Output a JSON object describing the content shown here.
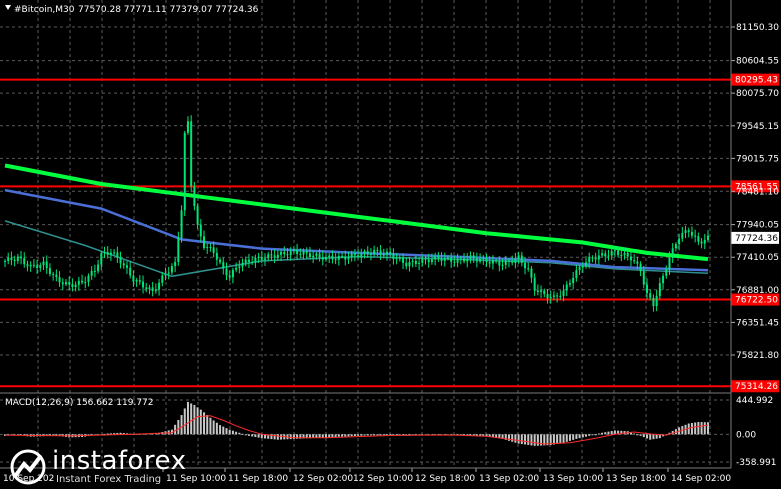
{
  "header": {
    "symbol": "#Bitcoin,M30",
    "ohlc": "77570.28 77771.11 77379.07 77724.36"
  },
  "colors": {
    "background": "#000000",
    "grid": "#5a5a5a",
    "candle": "#00e676",
    "sma_fast": "#00ff3c",
    "sma_mid": "#4a6fd6",
    "sma_slow": "#2f8f8f",
    "level": "#ff0000",
    "current_price_bg": "#ffffff",
    "macd_hist": "#c8c8c8",
    "macd_signal": "#ff2a2a"
  },
  "chart_data": {
    "type": "candlestick",
    "price_axis_ticks": [
      "81150.30",
      "80604.55",
      "80075.70",
      "79545.15",
      "79015.75",
      "78481.10",
      "77940.05",
      "77410.05",
      "76881.00",
      "76351.45",
      "75821.80"
    ],
    "price_axis_values": [
      81150.3,
      80604.55,
      80075.7,
      79545.15,
      79015.75,
      78481.1,
      77940.05,
      77410.05,
      76881.0,
      76351.45,
      75821.8
    ],
    "time_axis_ticks": [
      "11 Sep 10:00",
      "11 Sep 18:00",
      "12 Sep 02:00",
      "12 Sep 10:00",
      "12 Sep 18:00",
      "13 Sep 02:00",
      "13 Sep 10:00",
      "13 Sep 18:00",
      "14 Sep 02:00"
    ],
    "levels": [
      {
        "label": "80295.43",
        "value": 80295.43
      },
      {
        "label": "78561.55",
        "value": 78561.55
      },
      {
        "label": "76722.50",
        "value": 76722.5
      },
      {
        "label": "75314.26",
        "value": 75314.26
      }
    ],
    "current_price": {
      "label": "77724.36",
      "value": 77724.36
    },
    "close_path": [
      [
        0,
        77350
      ],
      [
        4,
        77400
      ],
      [
        8,
        77250
      ],
      [
        12,
        77300
      ],
      [
        16,
        77050
      ],
      [
        20,
        76950
      ],
      [
        24,
        77000
      ],
      [
        28,
        77200
      ],
      [
        30,
        77450
      ],
      [
        33,
        77500
      ],
      [
        36,
        77350
      ],
      [
        40,
        77050
      ],
      [
        43,
        76950
      ],
      [
        46,
        76850
      ],
      [
        50,
        77150
      ],
      [
        53,
        77300
      ],
      [
        55,
        78200
      ],
      [
        56,
        79400
      ],
      [
        57,
        79600
      ],
      [
        58,
        78600
      ],
      [
        60,
        77900
      ],
      [
        62,
        77600
      ],
      [
        65,
        77500
      ],
      [
        68,
        77200
      ],
      [
        70,
        77100
      ],
      [
        73,
        77300
      ],
      [
        76,
        77350
      ],
      [
        80,
        77400
      ],
      [
        85,
        77450
      ],
      [
        90,
        77500
      ],
      [
        95,
        77450
      ],
      [
        100,
        77400
      ],
      [
        105,
        77400
      ],
      [
        110,
        77450
      ],
      [
        115,
        77500
      ],
      [
        120,
        77450
      ],
      [
        125,
        77300
      ],
      [
        130,
        77350
      ],
      [
        135,
        77400
      ],
      [
        140,
        77350
      ],
      [
        145,
        77400
      ],
      [
        150,
        77350
      ],
      [
        155,
        77300
      ],
      [
        160,
        77400
      ],
      [
        163,
        77200
      ],
      [
        165,
        76900
      ],
      [
        168,
        76800
      ],
      [
        171,
        76750
      ],
      [
        174,
        76850
      ],
      [
        177,
        77100
      ],
      [
        180,
        77300
      ],
      [
        183,
        77400
      ],
      [
        187,
        77450
      ],
      [
        190,
        77500
      ],
      [
        195,
        77400
      ],
      [
        198,
        77200
      ],
      [
        200,
        76800
      ],
      [
        202,
        76650
      ],
      [
        204,
        76950
      ],
      [
        207,
        77400
      ],
      [
        210,
        77750
      ],
      [
        213,
        77850
      ],
      [
        216,
        77650
      ],
      [
        219,
        77720
      ]
    ],
    "sma_fast_path": [
      [
        0,
        78900
      ],
      [
        30,
        78600
      ],
      [
        60,
        78400
      ],
      [
        90,
        78200
      ],
      [
        120,
        78000
      ],
      [
        150,
        77800
      ],
      [
        180,
        77650
      ],
      [
        200,
        77480
      ],
      [
        219,
        77380
      ]
    ],
    "sma_mid_path": [
      [
        0,
        78500
      ],
      [
        30,
        78200
      ],
      [
        55,
        77700
      ],
      [
        80,
        77550
      ],
      [
        110,
        77480
      ],
      [
        140,
        77420
      ],
      [
        170,
        77350
      ],
      [
        190,
        77250
      ],
      [
        219,
        77200
      ]
    ],
    "sma_slow_path": [
      [
        0,
        78000
      ],
      [
        25,
        77600
      ],
      [
        52,
        77100
      ],
      [
        80,
        77350
      ],
      [
        110,
        77420
      ],
      [
        140,
        77380
      ],
      [
        170,
        77320
      ],
      [
        190,
        77220
      ],
      [
        219,
        77150
      ]
    ],
    "macd": {
      "label": "MACD(12,26,9) 156.662 119.772",
      "axis_ticks": [
        "444.992",
        "0.00",
        "-358.991"
      ],
      "axis_values": [
        444.992,
        0,
        -358.991
      ],
      "hist": [
        [
          0,
          -20
        ],
        [
          4,
          -10
        ],
        [
          8,
          -30
        ],
        [
          12,
          -25
        ],
        [
          16,
          -15
        ],
        [
          20,
          -40
        ],
        [
          24,
          -35
        ],
        [
          28,
          -10
        ],
        [
          32,
          10
        ],
        [
          36,
          20
        ],
        [
          40,
          5
        ],
        [
          44,
          10
        ],
        [
          48,
          20
        ],
        [
          52,
          60
        ],
        [
          55,
          250
        ],
        [
          57,
          420
        ],
        [
          59,
          380
        ],
        [
          61,
          320
        ],
        [
          63,
          250
        ],
        [
          65,
          180
        ],
        [
          67,
          120
        ],
        [
          70,
          60
        ],
        [
          73,
          20
        ],
        [
          76,
          -20
        ],
        [
          80,
          -50
        ],
        [
          85,
          -70
        ],
        [
          90,
          -60
        ],
        [
          95,
          -50
        ],
        [
          100,
          -40
        ],
        [
          105,
          -30
        ],
        [
          110,
          -20
        ],
        [
          115,
          -10
        ],
        [
          120,
          0
        ],
        [
          125,
          -20
        ],
        [
          130,
          -10
        ],
        [
          135,
          0
        ],
        [
          140,
          -10
        ],
        [
          145,
          -20
        ],
        [
          150,
          -30
        ],
        [
          155,
          -60
        ],
        [
          160,
          -120
        ],
        [
          165,
          -150
        ],
        [
          170,
          -140
        ],
        [
          174,
          -110
        ],
        [
          178,
          -60
        ],
        [
          182,
          -20
        ],
        [
          186,
          20
        ],
        [
          190,
          50
        ],
        [
          194,
          40
        ],
        [
          198,
          -20
        ],
        [
          201,
          -70
        ],
        [
          204,
          -50
        ],
        [
          207,
          20
        ],
        [
          210,
          90
        ],
        [
          213,
          140
        ],
        [
          216,
          160
        ],
        [
          219,
          156
        ]
      ],
      "signal": [
        [
          0,
          -10
        ],
        [
          20,
          -20
        ],
        [
          40,
          0
        ],
        [
          52,
          20
        ],
        [
          56,
          120
        ],
        [
          60,
          230
        ],
        [
          64,
          240
        ],
        [
          68,
          180
        ],
        [
          72,
          110
        ],
        [
          76,
          50
        ],
        [
          80,
          0
        ],
        [
          90,
          -45
        ],
        [
          100,
          -45
        ],
        [
          110,
          -30
        ],
        [
          120,
          -15
        ],
        [
          130,
          -10
        ],
        [
          140,
          -10
        ],
        [
          150,
          -25
        ],
        [
          160,
          -80
        ],
        [
          168,
          -125
        ],
        [
          176,
          -110
        ],
        [
          184,
          -50
        ],
        [
          190,
          0
        ],
        [
          196,
          30
        ],
        [
          202,
          0
        ],
        [
          206,
          -10
        ],
        [
          210,
          40
        ],
        [
          214,
          90
        ],
        [
          219,
          120
        ]
      ]
    }
  },
  "watermark": {
    "name": "instaforex",
    "tagline": "Instant Forex Trading",
    "left_time_label": "10 Sep 202",
    "left_time_label_2": "ep 10:00"
  }
}
